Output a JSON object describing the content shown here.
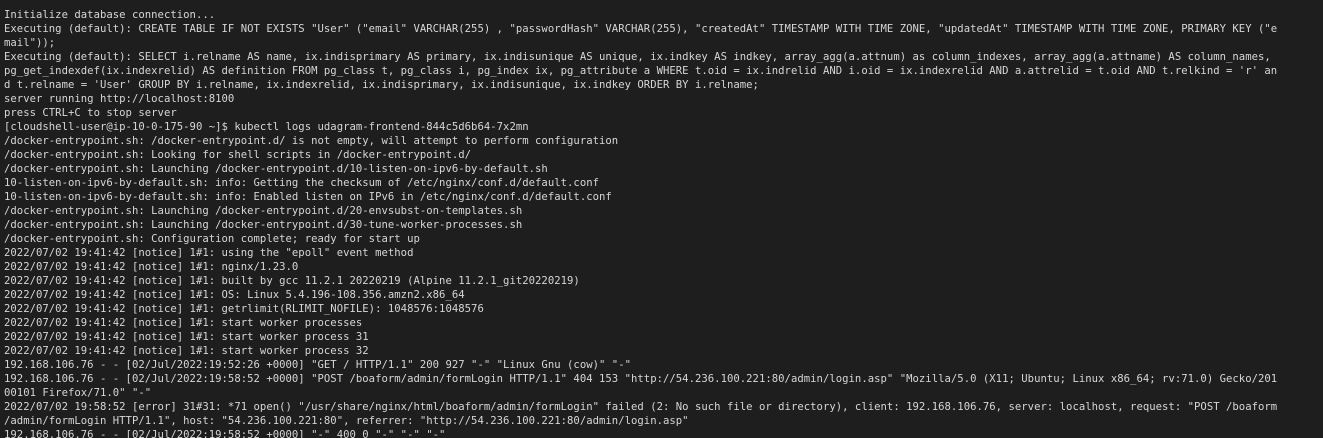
{
  "terminal": {
    "lines": [
      "Initialize database connection...",
      "Executing (default): CREATE TABLE IF NOT EXISTS \"User\" (\"email\" VARCHAR(255) , \"passwordHash\" VARCHAR(255), \"createdAt\" TIMESTAMP WITH TIME ZONE, \"updatedAt\" TIMESTAMP WITH TIME ZONE, PRIMARY KEY (\"e",
      "mail\"));",
      "Executing (default): SELECT i.relname AS name, ix.indisprimary AS primary, ix.indisunique AS unique, ix.indkey AS indkey, array_agg(a.attnum) as column_indexes, array_agg(a.attname) AS column_names,",
      "pg_get_indexdef(ix.indexrelid) AS definition FROM pg_class t, pg_class i, pg_index ix, pg_attribute a WHERE t.oid = ix.indrelid AND i.oid = ix.indexrelid AND a.attrelid = t.oid AND t.relkind = 'r' an",
      "d t.relname = 'User' GROUP BY i.relname, ix.indexrelid, ix.indisprimary, ix.indisunique, ix.indkey ORDER BY i.relname;",
      "server running http://localhost:8100",
      "press CTRL+C to stop server",
      "[cloudshell-user@ip-10-0-175-90 ~]$ kubectl logs udagram-frontend-844c5d6b64-7x2mn",
      "/docker-entrypoint.sh: /docker-entrypoint.d/ is not empty, will attempt to perform configuration",
      "/docker-entrypoint.sh: Looking for shell scripts in /docker-entrypoint.d/",
      "/docker-entrypoint.sh: Launching /docker-entrypoint.d/10-listen-on-ipv6-by-default.sh",
      "10-listen-on-ipv6-by-default.sh: info: Getting the checksum of /etc/nginx/conf.d/default.conf",
      "10-listen-on-ipv6-by-default.sh: info: Enabled listen on IPv6 in /etc/nginx/conf.d/default.conf",
      "/docker-entrypoint.sh: Launching /docker-entrypoint.d/20-envsubst-on-templates.sh",
      "/docker-entrypoint.sh: Launching /docker-entrypoint.d/30-tune-worker-processes.sh",
      "/docker-entrypoint.sh: Configuration complete; ready for start up",
      "2022/07/02 19:41:42 [notice] 1#1: using the \"epoll\" event method",
      "2022/07/02 19:41:42 [notice] 1#1: nginx/1.23.0",
      "2022/07/02 19:41:42 [notice] 1#1: built by gcc 11.2.1 20220219 (Alpine 11.2.1_git20220219)",
      "2022/07/02 19:41:42 [notice] 1#1: OS: Linux 5.4.196-108.356.amzn2.x86_64",
      "2022/07/02 19:41:42 [notice] 1#1: getrlimit(RLIMIT_NOFILE): 1048576:1048576",
      "2022/07/02 19:41:42 [notice] 1#1: start worker processes",
      "2022/07/02 19:41:42 [notice] 1#1: start worker process 31",
      "2022/07/02 19:41:42 [notice] 1#1: start worker process 32",
      "192.168.106.76 - - [02/Jul/2022:19:52:26 +0000] \"GET / HTTP/1.1\" 200 927 \"-\" \"Linux Gnu (cow)\" \"-\"",
      "192.168.106.76 - - [02/Jul/2022:19:58:52 +0000] \"POST /boaform/admin/formLogin HTTP/1.1\" 404 153 \"http://54.236.100.221:80/admin/login.asp\" \"Mozilla/5.0 (X11; Ubuntu; Linux x86_64; rv:71.0) Gecko/201",
      "00101 Firefox/71.0\" \"-\"",
      "2022/07/02 19:58:52 [error] 31#31: *71 open() \"/usr/share/nginx/html/boaform/admin/formLogin\" failed (2: No such file or directory), client: 192.168.106.76, server: localhost, request: \"POST /boaform",
      "/admin/formLogin HTTP/1.1\", host: \"54.236.100.221:80\", referrer: \"http://54.236.100.221:80/admin/login.asp\"",
      "192.168.106.76 - - [02/Jul/2022:19:58:52 +0000] \"-\" 400 0 \"-\" \"-\" \"-\""
    ]
  }
}
